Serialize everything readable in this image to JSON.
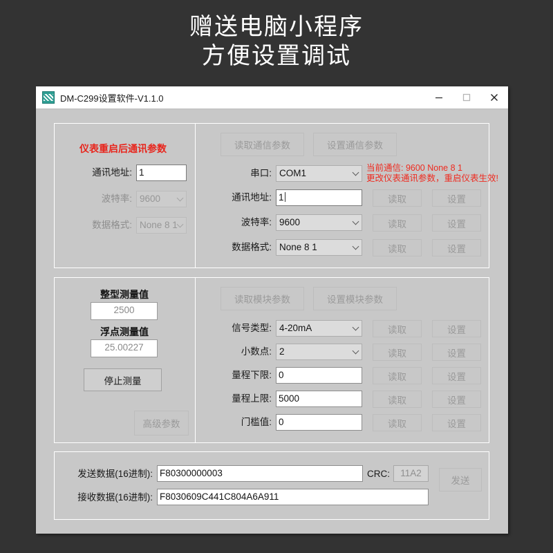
{
  "banner": {
    "line1": "赠送电脑小程序",
    "line2": "方便设置调试"
  },
  "window": {
    "title": "DM-C299设置软件-V1.1.0",
    "icon": "app-icon",
    "controls": {
      "minimize": "–",
      "maximize": "□",
      "close": "✕"
    }
  },
  "comm_group": {
    "left": {
      "header": "仪表重启后通讯参数",
      "rows": [
        {
          "label": "通讯地址:",
          "value": "1",
          "type": "text",
          "disabled": false
        },
        {
          "label": "波特率:",
          "value": "9600",
          "type": "combo",
          "disabled": true
        },
        {
          "label": "数据格式:",
          "value": "None 8 1",
          "type": "combo",
          "disabled": true
        }
      ]
    },
    "right": {
      "read_params_button": "读取通信参数",
      "set_params_button": "设置通信参数",
      "warning_line1": "当前通信: 9600 None 8 1",
      "warning_line2": "更改仪表通讯参数，重启仪表生效!",
      "port_label": "串口:",
      "port_value": "COM1",
      "rows": [
        {
          "label": "通讯地址:",
          "value": "1",
          "type": "text",
          "read": "读取",
          "set": "设置"
        },
        {
          "label": "波特率:",
          "value": "9600",
          "type": "combo",
          "read": "读取",
          "set": "设置"
        },
        {
          "label": "数据格式:",
          "value": "None 8 1",
          "type": "combo",
          "read": "读取",
          "set": "设置"
        }
      ]
    }
  },
  "module_group": {
    "left": {
      "int_title": "整型测量值",
      "int_value": "2500",
      "float_title": "浮点测量值",
      "float_value": "25.00227",
      "stop_button": "停止测量",
      "advanced_button": "高级参数"
    },
    "right": {
      "read_params_button": "读取模块参数",
      "set_params_button": "设置模块参数",
      "rows": [
        {
          "label": "信号类型:",
          "value": "4-20mA",
          "type": "combo",
          "read": "读取",
          "set": "设置"
        },
        {
          "label": "小数点:",
          "value": "2",
          "type": "combo",
          "read": "读取",
          "set": "设置"
        },
        {
          "label": "量程下限:",
          "value": "0",
          "type": "text",
          "read": "读取",
          "set": "设置"
        },
        {
          "label": "量程上限:",
          "value": "5000",
          "type": "text",
          "read": "读取",
          "set": "设置"
        },
        {
          "label": "门槛值:",
          "value": "0",
          "type": "text",
          "read": "读取",
          "set": "设置"
        }
      ]
    }
  },
  "data_group": {
    "send_label": "发送数据(16进制):",
    "send_value": "F80300000003",
    "crc_label": "CRC:",
    "crc_value": "11A2",
    "send_button": "发送",
    "recv_label": "接收数据(16进制):",
    "recv_value": "F8030609C441C804A6A911"
  },
  "colors": {
    "page_bg": "#333333",
    "window_bg": "#c8c8c8",
    "titlebar_bg": "#ffffff",
    "accent_red": "#e8251c",
    "icon_teal": "#2f9e93"
  }
}
